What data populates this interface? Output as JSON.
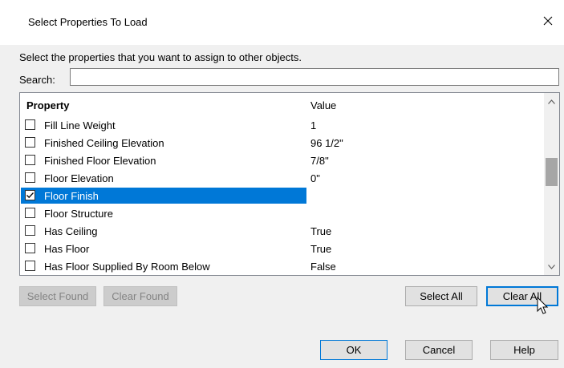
{
  "window": {
    "title": "Select Properties To Load",
    "close_icon": "close-icon"
  },
  "instructions": "Select the properties that you want to assign to other objects.",
  "search": {
    "label": "Search:",
    "value": "",
    "placeholder": ""
  },
  "grid": {
    "headers": {
      "property": "Property",
      "value": "Value"
    },
    "rows": [
      {
        "property": "Fill Line Weight",
        "value": "1",
        "checked": false,
        "selected": false
      },
      {
        "property": "Finished Ceiling Elevation",
        "value": "96 1/2\"",
        "checked": false,
        "selected": false
      },
      {
        "property": "Finished Floor Elevation",
        "value": "7/8\"",
        "checked": false,
        "selected": false
      },
      {
        "property": "Floor Elevation",
        "value": "0\"",
        "checked": false,
        "selected": false
      },
      {
        "property": "Floor Finish",
        "value": "",
        "checked": true,
        "selected": true
      },
      {
        "property": "Floor Structure",
        "value": "",
        "checked": false,
        "selected": false
      },
      {
        "property": "Has Ceiling",
        "value": "True",
        "checked": false,
        "selected": false
      },
      {
        "property": "Has Floor",
        "value": "True",
        "checked": false,
        "selected": false
      },
      {
        "property": "Has Floor Supplied By Room Below",
        "value": "False",
        "checked": false,
        "selected": false
      }
    ]
  },
  "buttons": {
    "select_found": "Select Found",
    "clear_found": "Clear Found",
    "select_all": "Select All",
    "clear_all": "Clear All",
    "ok": "OK",
    "cancel": "Cancel",
    "help": "Help"
  },
  "colors": {
    "selection": "#0078d7",
    "dialog_bg": "#f0f0f0"
  }
}
